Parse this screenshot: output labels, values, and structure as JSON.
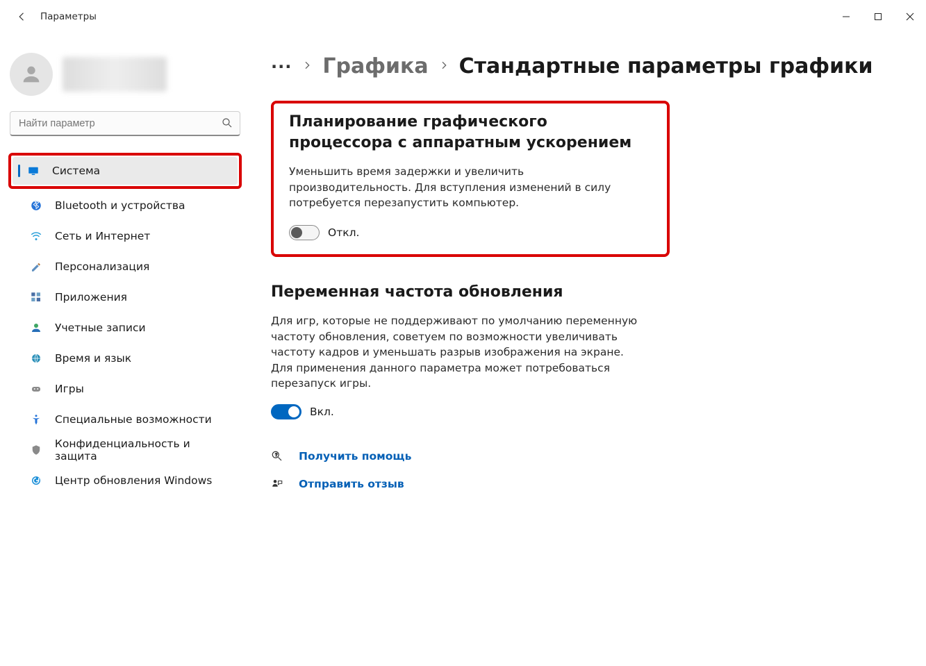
{
  "window": {
    "title": "Параметры"
  },
  "search": {
    "placeholder": "Найти параметр"
  },
  "sidebar": {
    "items": [
      {
        "label": "Система",
        "selected": true,
        "highlighted": true
      },
      {
        "label": "Bluetooth и устройства"
      },
      {
        "label": "Сеть и Интернет"
      },
      {
        "label": "Персонализация"
      },
      {
        "label": "Приложения"
      },
      {
        "label": "Учетные записи"
      },
      {
        "label": "Время и язык"
      },
      {
        "label": "Игры"
      },
      {
        "label": "Специальные возможности"
      },
      {
        "label": "Конфиденциальность и защита"
      },
      {
        "label": "Центр обновления Windows"
      }
    ]
  },
  "breadcrumb": {
    "dots": "···",
    "part1": "Графика",
    "current": "Стандартные параметры графики"
  },
  "section_gpu": {
    "title": "Планирование графического процессора с аппаратным ускорением",
    "desc": "Уменьшить время задержки и увеличить производительность. Для вступления изменений в силу потребуется перезапустить компьютер.",
    "toggle_label": "Откл.",
    "toggle_on": false
  },
  "section_vrr": {
    "title": "Переменная частота обновления",
    "desc": "Для игр, которые не поддерживают по умолчанию переменную частоту обновления, советуем по возможности увеличивать частоту кадров и уменьшать разрыв изображения на экране. Для применения данного параметра может потребоваться перезапуск игры.",
    "toggle_label": "Вкл.",
    "toggle_on": true
  },
  "links": {
    "help": "Получить помощь",
    "feedback": "Отправить отзыв"
  }
}
